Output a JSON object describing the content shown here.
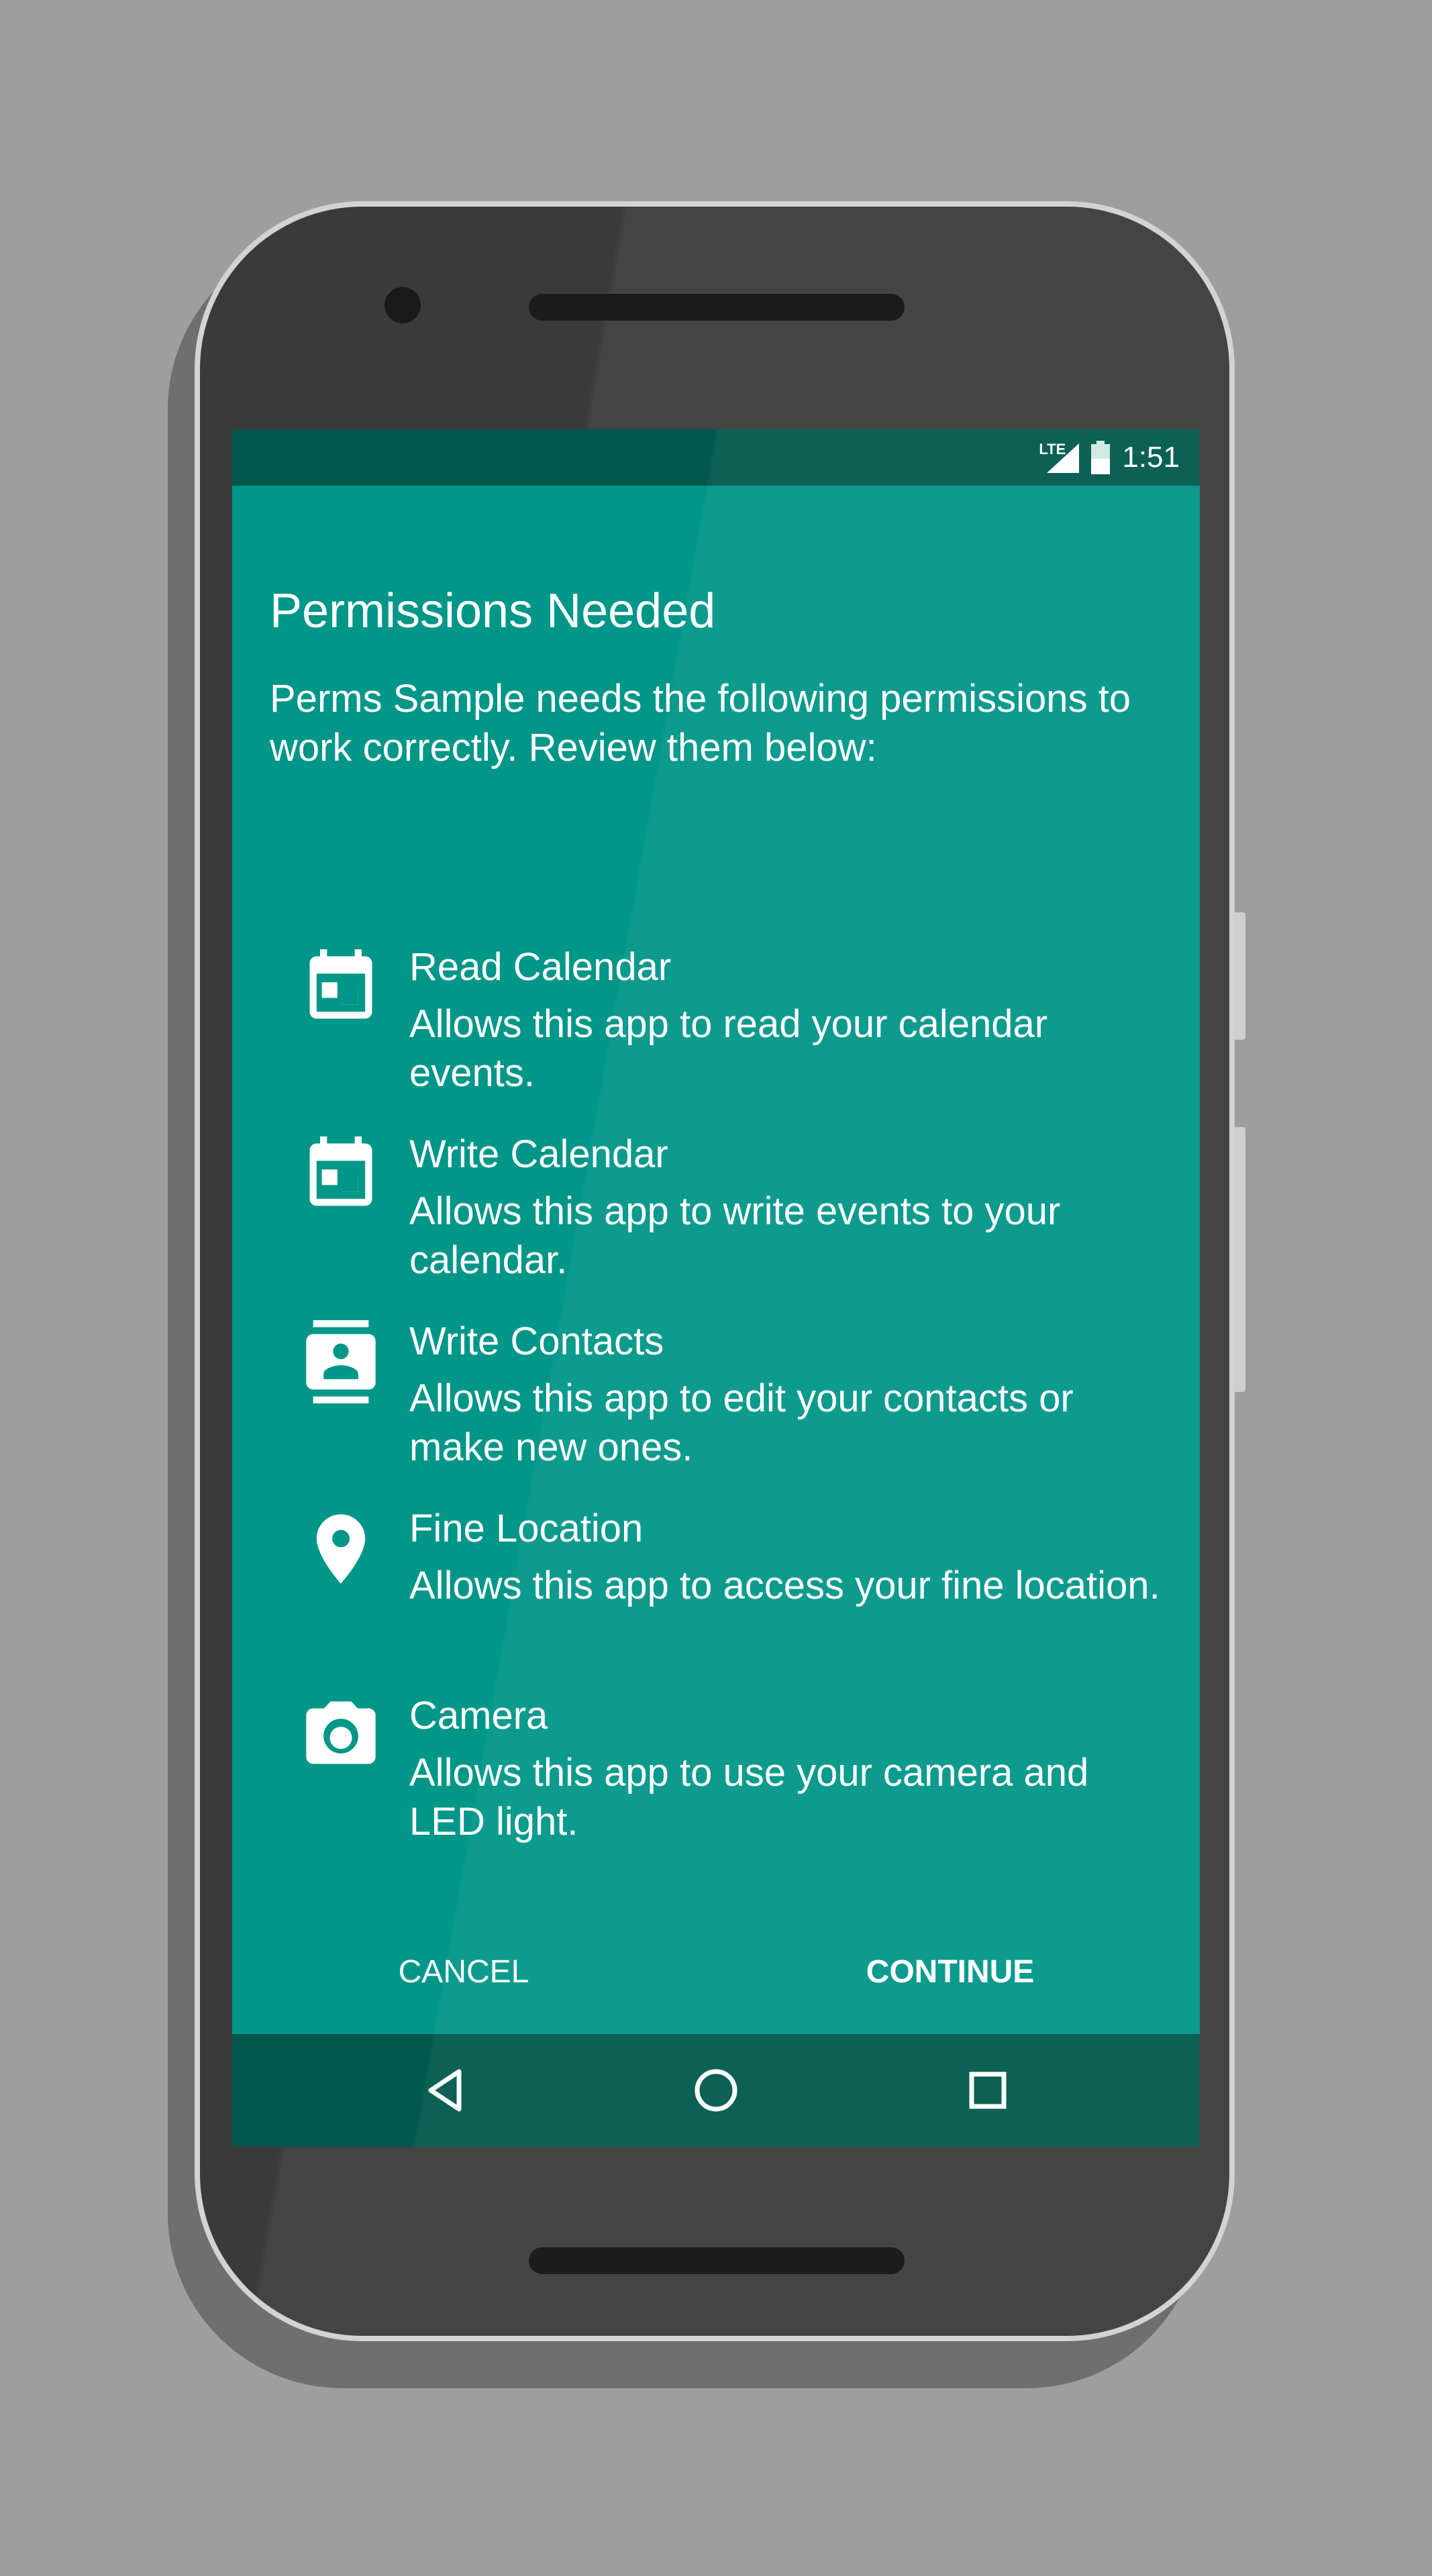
{
  "status_bar": {
    "network": "LTE",
    "time": "1:51",
    "battery_level": 0.5
  },
  "dialog": {
    "title": "Permissions Needed",
    "intro": "Perms Sample needs the following permissions to work correctly. Review them below:",
    "permissions": [
      {
        "icon": "calendar-icon",
        "title": "Read Calendar",
        "description": "Allows this app to read your calendar events."
      },
      {
        "icon": "calendar-icon",
        "title": "Write Calendar",
        "description": "Allows this app to write events to your calendar."
      },
      {
        "icon": "contacts-icon",
        "title": "Write Contacts",
        "description": "Allows this app to edit your contacts or make new ones."
      },
      {
        "icon": "location-pin-icon",
        "title": "Fine Location",
        "description": "Allows this app to access your fine location."
      },
      {
        "icon": "camera-icon",
        "title": "Camera",
        "description": "Allows this app to use your camera and LED light."
      }
    ],
    "cancel_label": "CANCEL",
    "continue_label": "CONTINUE"
  },
  "nav_bar": {
    "items": [
      "back-icon",
      "home-icon",
      "recents-icon"
    ]
  },
  "colors": {
    "screen_background": "#009688",
    "status_bar_background": "#00574b",
    "text": "#ffffff"
  }
}
